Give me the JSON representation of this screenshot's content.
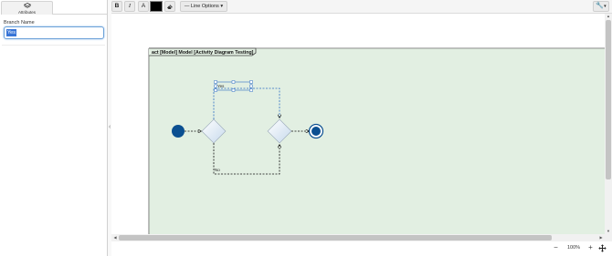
{
  "attributes_tab": {
    "label": "Attributes",
    "icon": "attributes-icon"
  },
  "form": {
    "branch_name_label": "Branch Name",
    "branch_name_value": "Yes"
  },
  "toolbar": {
    "bold_label": "B",
    "italic_label": "I",
    "font_color_label": "A",
    "color_swatch": "#000000",
    "eraser_icon": "eraser-icon",
    "line_options_label": "Line Options",
    "line_options_icon": "line-style-icon",
    "settings_icon": "wrench-icon"
  },
  "diagram": {
    "frame_title": "act [Model] Model [Activity Diagram Testing]",
    "frame_fill": "#e2efe2",
    "yes_label": "Yes",
    "no_label": "No",
    "node_color": "#0b4f91",
    "selection_color": "#2f6fc4"
  },
  "zoom": {
    "level": "100%",
    "zoom_out_label": "−",
    "zoom_in_label": "+"
  }
}
